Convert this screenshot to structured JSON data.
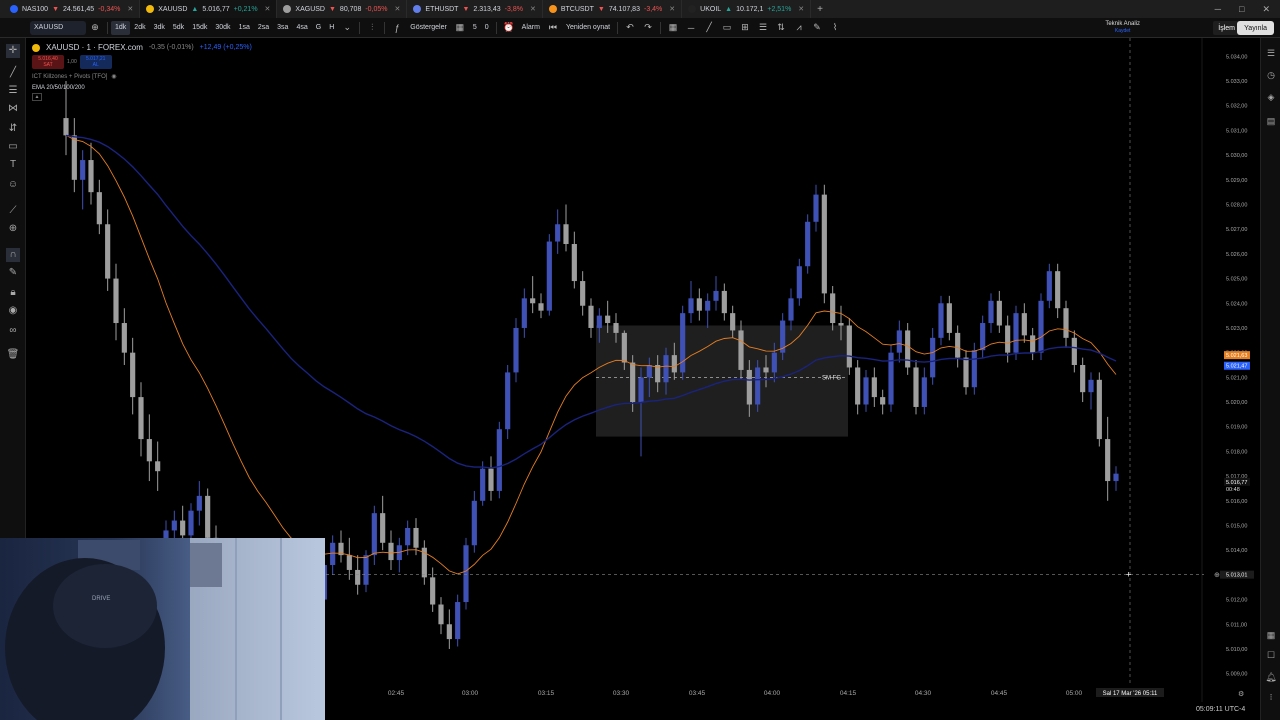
{
  "tabs": [
    {
      "symbol": "NAS100",
      "price": "24.561,45",
      "dir": "down",
      "change": "-0,34%",
      "color": "#2962ff"
    },
    {
      "symbol": "XAUUSD",
      "price": "5.016,77",
      "dir": "up",
      "change": "+0,21%",
      "color": "#f0b90b",
      "active": true
    },
    {
      "symbol": "XAGUSD",
      "price": "80,708",
      "dir": "down",
      "change": "-0,05%",
      "color": "#9e9e9e"
    },
    {
      "symbol": "ETHUSDT",
      "price": "2.313,43",
      "dir": "down",
      "change": "-3,8%",
      "color": "#627eea"
    },
    {
      "symbol": "BTCUSDT",
      "price": "74.107,83",
      "dir": "down",
      "change": "-3,4%",
      "color": "#f7931a"
    },
    {
      "symbol": "UKOIL",
      "price": "10.172,1",
      "dir": "up",
      "change": "+2,51%",
      "color": "#222222"
    }
  ],
  "toolbar": {
    "symbol": "XAUUSD",
    "intervals": [
      "1dk",
      "2dk",
      "3dk",
      "5dk",
      "15dk",
      "30dk",
      "1sa",
      "2sa",
      "3sa",
      "4sa",
      "G",
      "H"
    ],
    "selected_interval": "1dk",
    "indicators_label": "Göstergeler",
    "indicator_count_a": "5",
    "indicator_count_b": "0",
    "alarm_label": "Alarm",
    "replay_label": "Yeniden oynat",
    "ta_label": "Teknik Analiz",
    "ta_sub": "Kaydet",
    "trade_label": "İşlem",
    "publish_label": "Yayınla"
  },
  "legend": {
    "title": "XAUUSD · 1 · FOREX.com",
    "change": "-0,35 (-0,01%)",
    "volume": "+12,49 (+0,25%)",
    "sell_price": "5.016,40",
    "sell_label": "SAT",
    "spread": "1,00",
    "buy_price": "5.017,21",
    "buy_label": "AL",
    "indicator_1": "ICT Killzones + Pivots [TFO]",
    "indicator_2": "EMA 20/50/100/200"
  },
  "box_label": "SM FG",
  "crosshair": {
    "time": "Sal 17 Mar '26  05:11",
    "price": "5.013,01"
  },
  "price_labels": {
    "ema_a": "5.021,63",
    "ema_b": "5.021,47",
    "last": "5.016,77",
    "countdown": "00:48"
  },
  "clock": "05:09:11 UTC-4",
  "chart_data": {
    "type": "candlestick",
    "ylim": [
      5008.5,
      5034.5
    ],
    "y_ticks": [
      "5.009,00",
      "5.010,00",
      "5.011,00",
      "5.012,00",
      "5.013,00",
      "5.014,00",
      "5.015,00",
      "5.016,00",
      "5.017,00",
      "5.018,00",
      "5.019,00",
      "5.020,00",
      "5.021,00",
      "5.022,00",
      "5.023,00",
      "5.024,00",
      "5.025,00",
      "5.026,00",
      "5.027,00",
      "5.028,00",
      "5.029,00",
      "5.030,00",
      "5.031,00",
      "5.032,00",
      "5.033,00",
      "5.034,00"
    ],
    "x_ticks": [
      "02:45",
      "03:00",
      "03:15",
      "03:30",
      "03:45",
      "04:00",
      "04:15",
      "04:30",
      "04:45",
      "05:00"
    ],
    "up_color": "#3f51b5",
    "down_color": "#9e9e9e",
    "candles": [
      [
        5031.5,
        5033.0,
        5030.0,
        5030.8
      ],
      [
        5030.8,
        5031.5,
        5028.5,
        5029.0
      ],
      [
        5029.0,
        5030.2,
        5027.8,
        5029.8
      ],
      [
        5029.8,
        5030.5,
        5028.0,
        5028.5
      ],
      [
        5028.5,
        5029.0,
        5026.8,
        5027.2
      ],
      [
        5027.2,
        5027.8,
        5024.5,
        5025.0
      ],
      [
        5025.0,
        5025.6,
        5022.5,
        5023.2
      ],
      [
        5023.2,
        5023.8,
        5021.5,
        5022.0
      ],
      [
        5022.0,
        5022.6,
        5019.5,
        5020.2
      ],
      [
        5020.2,
        5020.8,
        5017.8,
        5018.5
      ],
      [
        5018.5,
        5019.5,
        5016.8,
        5017.6
      ],
      [
        5017.6,
        5018.4,
        5016.4,
        5017.2
      ],
      [
        5014.0,
        5015.2,
        5013.1,
        5014.8
      ],
      [
        5014.8,
        5015.6,
        5014.0,
        5015.2
      ],
      [
        5015.2,
        5015.8,
        5014.2,
        5014.6
      ],
      [
        5014.6,
        5015.9,
        5014.2,
        5015.6
      ],
      [
        5015.6,
        5016.8,
        5015.0,
        5016.2
      ],
      [
        5016.2,
        5016.5,
        5014.0,
        5014.5
      ],
      [
        5014.5,
        5015.0,
        5012.8,
        5013.2
      ],
      [
        5013.2,
        5013.6,
        5011.5,
        5012.0
      ],
      [
        5012.0,
        5012.5,
        5010.6,
        5011.0
      ],
      [
        5011.0,
        5011.6,
        5010.2,
        5010.8
      ],
      [
        5010.8,
        5011.3,
        5010.0,
        5010.5
      ],
      [
        5010.5,
        5011.4,
        5010.0,
        5011.2
      ],
      [
        5011.2,
        5012.0,
        5010.6,
        5011.6
      ],
      [
        5011.6,
        5011.9,
        5010.4,
        5010.7
      ],
      [
        5010.7,
        5011.0,
        5009.6,
        5010.0
      ],
      [
        5010.0,
        5010.8,
        5009.3,
        5010.5
      ],
      [
        5010.5,
        5012.2,
        5010.2,
        5011.9
      ],
      [
        5011.9,
        5013.0,
        5011.5,
        5012.5
      ],
      [
        5012.5,
        5013.2,
        5011.8,
        5012.0
      ],
      [
        5012.0,
        5013.6,
        5011.8,
        5013.4
      ],
      [
        5013.4,
        5014.6,
        5013.0,
        5014.3
      ],
      [
        5014.3,
        5014.8,
        5013.5,
        5013.8
      ],
      [
        5013.8,
        5014.5,
        5012.8,
        5013.2
      ],
      [
        5013.2,
        5013.8,
        5012.2,
        5012.6
      ],
      [
        5012.6,
        5014.0,
        5012.3,
        5013.8
      ],
      [
        5013.8,
        5015.8,
        5013.4,
        5015.5
      ],
      [
        5015.5,
        5016.2,
        5014.0,
        5014.3
      ],
      [
        5014.3,
        5014.8,
        5013.2,
        5013.6
      ],
      [
        5013.6,
        5014.5,
        5013.1,
        5014.2
      ],
      [
        5014.2,
        5015.2,
        5013.8,
        5014.9
      ],
      [
        5014.9,
        5015.3,
        5013.8,
        5014.1
      ],
      [
        5014.1,
        5014.4,
        5012.6,
        5012.9
      ],
      [
        5012.9,
        5013.3,
        5011.5,
        5011.8
      ],
      [
        5011.8,
        5012.1,
        5010.6,
        5011.0
      ],
      [
        5011.0,
        5011.6,
        5010.0,
        5010.4
      ],
      [
        5010.4,
        5012.2,
        5010.1,
        5011.9
      ],
      [
        5011.9,
        5014.5,
        5011.6,
        5014.2
      ],
      [
        5014.2,
        5016.4,
        5013.9,
        5016.0
      ],
      [
        5016.0,
        5017.6,
        5015.8,
        5017.3
      ],
      [
        5017.3,
        5017.8,
        5016.0,
        5016.4
      ],
      [
        5016.4,
        5019.2,
        5016.1,
        5018.9
      ],
      [
        5018.9,
        5021.5,
        5018.5,
        5021.2
      ],
      [
        5021.2,
        5023.4,
        5020.8,
        5023.0
      ],
      [
        5023.0,
        5024.6,
        5022.6,
        5024.2
      ],
      [
        5024.2,
        5025.1,
        5023.6,
        5024.0
      ],
      [
        5024.0,
        5024.4,
        5023.4,
        5023.7
      ],
      [
        5023.7,
        5026.8,
        5023.5,
        5026.5
      ],
      [
        5026.5,
        5027.8,
        5026.0,
        5027.2
      ],
      [
        5027.2,
        5028.0,
        5026.1,
        5026.4
      ],
      [
        5026.4,
        5026.9,
        5024.6,
        5024.9
      ],
      [
        5024.9,
        5025.3,
        5023.5,
        5023.9
      ],
      [
        5023.9,
        5024.2,
        5022.6,
        5023.0
      ],
      [
        5023.0,
        5023.8,
        5022.4,
        5023.5
      ],
      [
        5023.5,
        5024.1,
        5022.8,
        5023.2
      ],
      [
        5023.2,
        5023.6,
        5022.4,
        5022.8
      ],
      [
        5022.8,
        5022.9,
        5021.3,
        5021.6
      ],
      [
        5021.6,
        5021.9,
        5019.6,
        5020.0
      ],
      [
        5020.0,
        5021.4,
        5017.8,
        5021.0
      ],
      [
        5021.0,
        5021.8,
        5020.2,
        5021.5
      ],
      [
        5021.5,
        5021.9,
        5020.4,
        5020.8
      ],
      [
        5020.8,
        5022.2,
        5020.3,
        5021.9
      ],
      [
        5021.9,
        5022.4,
        5020.9,
        5021.2
      ],
      [
        5021.2,
        5023.9,
        5020.9,
        5023.6
      ],
      [
        5023.6,
        5024.9,
        5023.2,
        5024.2
      ],
      [
        5024.2,
        5024.6,
        5023.3,
        5023.7
      ],
      [
        5023.7,
        5024.4,
        5023.0,
        5024.1
      ],
      [
        5024.1,
        5025.1,
        5023.7,
        5024.5
      ],
      [
        5024.5,
        5024.8,
        5023.3,
        5023.6
      ],
      [
        5023.6,
        5023.9,
        5022.6,
        5022.9
      ],
      [
        5022.9,
        5023.3,
        5020.9,
        5021.3
      ],
      [
        5021.3,
        5021.7,
        5019.4,
        5019.9
      ],
      [
        5019.9,
        5021.7,
        5019.6,
        5021.4
      ],
      [
        5021.4,
        5021.9,
        5020.6,
        5021.2
      ],
      [
        5021.2,
        5022.4,
        5020.8,
        5022.0
      ],
      [
        5022.0,
        5023.6,
        5021.7,
        5023.3
      ],
      [
        5023.3,
        5024.6,
        5022.9,
        5024.2
      ],
      [
        5024.2,
        5025.8,
        5023.9,
        5025.5
      ],
      [
        5025.5,
        5027.6,
        5025.2,
        5027.3
      ],
      [
        5027.3,
        5028.8,
        5026.9,
        5028.4
      ],
      [
        5028.4,
        5028.8,
        5024.0,
        5024.4
      ],
      [
        5024.4,
        5024.7,
        5022.9,
        5023.2
      ],
      [
        5023.2,
        5023.9,
        5022.5,
        5023.1
      ],
      [
        5023.1,
        5023.4,
        5021.1,
        5021.4
      ],
      [
        5021.4,
        5021.7,
        5019.5,
        5019.9
      ],
      [
        5019.9,
        5021.3,
        5019.6,
        5021.0
      ],
      [
        5021.0,
        5021.4,
        5019.8,
        5020.2
      ],
      [
        5020.2,
        5020.5,
        5019.5,
        5019.9
      ],
      [
        5019.9,
        5022.3,
        5019.6,
        5022.0
      ],
      [
        5022.0,
        5023.3,
        5021.6,
        5022.9
      ],
      [
        5022.9,
        5023.2,
        5021.1,
        5021.4
      ],
      [
        5021.4,
        5021.7,
        5019.5,
        5019.8
      ],
      [
        5019.8,
        5021.4,
        5019.5,
        5021.0
      ],
      [
        5021.0,
        5023.0,
        5020.7,
        5022.6
      ],
      [
        5022.6,
        5024.3,
        5022.3,
        5024.0
      ],
      [
        5024.0,
        5024.3,
        5022.5,
        5022.8
      ],
      [
        5022.8,
        5023.1,
        5021.4,
        5021.8
      ],
      [
        5021.8,
        5022.1,
        5020.3,
        5020.6
      ],
      [
        5020.6,
        5022.4,
        5020.3,
        5022.1
      ],
      [
        5022.1,
        5023.5,
        5021.8,
        5023.2
      ],
      [
        5023.2,
        5024.4,
        5022.8,
        5024.1
      ],
      [
        5024.1,
        5024.5,
        5022.8,
        5023.1
      ],
      [
        5023.1,
        5023.5,
        5021.6,
        5022.0
      ],
      [
        5022.0,
        5023.9,
        5021.7,
        5023.6
      ],
      [
        5023.6,
        5024.0,
        5022.4,
        5022.7
      ],
      [
        5022.7,
        5023.0,
        5021.7,
        5022.0
      ],
      [
        5022.0,
        5024.4,
        5021.7,
        5024.1
      ],
      [
        5024.1,
        5025.6,
        5023.8,
        5025.3
      ],
      [
        5025.3,
        5025.6,
        5023.4,
        5023.8
      ],
      [
        5023.8,
        5024.1,
        5022.2,
        5022.6
      ],
      [
        5022.6,
        5022.9,
        5021.2,
        5021.5
      ],
      [
        5021.5,
        5021.8,
        5020.0,
        5020.4
      ],
      [
        5020.4,
        5021.2,
        5019.7,
        5020.9
      ],
      [
        5020.9,
        5021.2,
        5018.2,
        5018.5
      ],
      [
        5018.5,
        5019.4,
        5016.0,
        5016.8
      ],
      [
        5016.8,
        5017.4,
        5016.4,
        5017.1
      ]
    ]
  }
}
